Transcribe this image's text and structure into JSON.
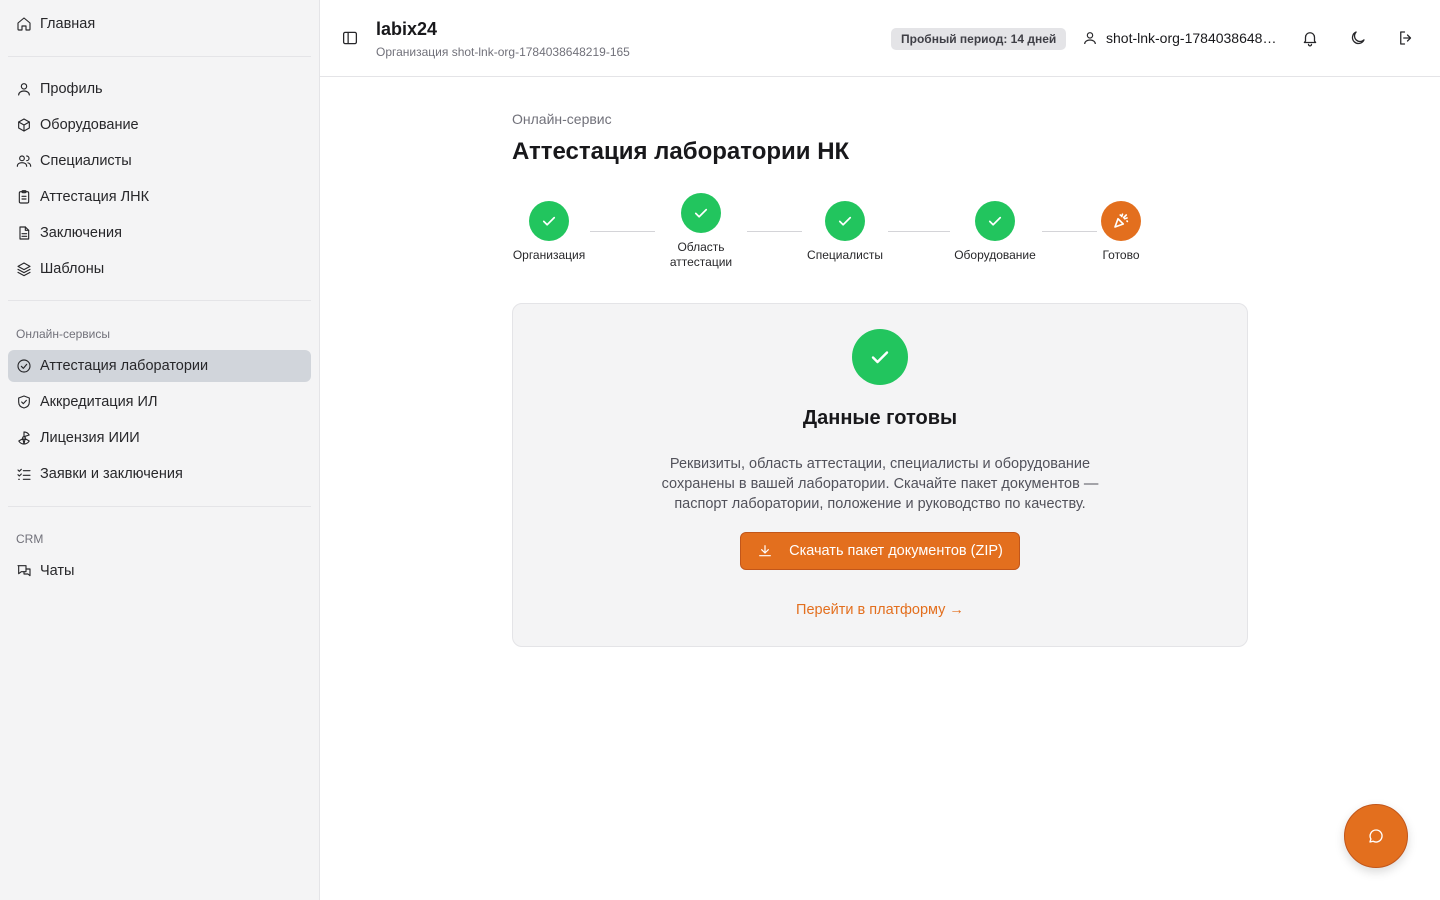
{
  "sidebar": {
    "home": "Главная",
    "items": [
      "Профиль",
      "Оборудование",
      "Специалисты",
      "Аттестация ЛНК",
      "Заключения",
      "Шаблоны"
    ],
    "online_label": "Онлайн-сервисы",
    "online_items": [
      "Аттестация лаборатории",
      "Аккредитация ИЛ",
      "Лицензия ИИИ",
      "Заявки и заключения"
    ],
    "crm_label": "CRM",
    "crm_items": [
      "Чаты"
    ]
  },
  "header": {
    "brand": "labix24",
    "org_line": "Организация shot-lnk-org-1784038648219-165",
    "trial": "Пробный период: 14 дней",
    "user": "shot-lnk-org-1784038648219-165"
  },
  "main": {
    "breadcrumb": "Онлайн-сервис",
    "title": "Аттестация лаборатории НК",
    "steps": [
      "Организация",
      "Область аттестации",
      "Специалисты",
      "Оборудование",
      "Готово"
    ]
  },
  "card": {
    "title": "Данные готовы",
    "description": "Реквизиты, область аттестации, специалисты и оборудование сохранены в вашей лаборатории. Скачайте пакет документов — паспорт лаборатории, положение и руководство по качеству.",
    "download_label": "Скачать пакет документов (ZIP)",
    "platform_link": "Перейти в платформу →"
  },
  "colors": {
    "accent": "#e36f1e",
    "success": "#22c55e"
  }
}
